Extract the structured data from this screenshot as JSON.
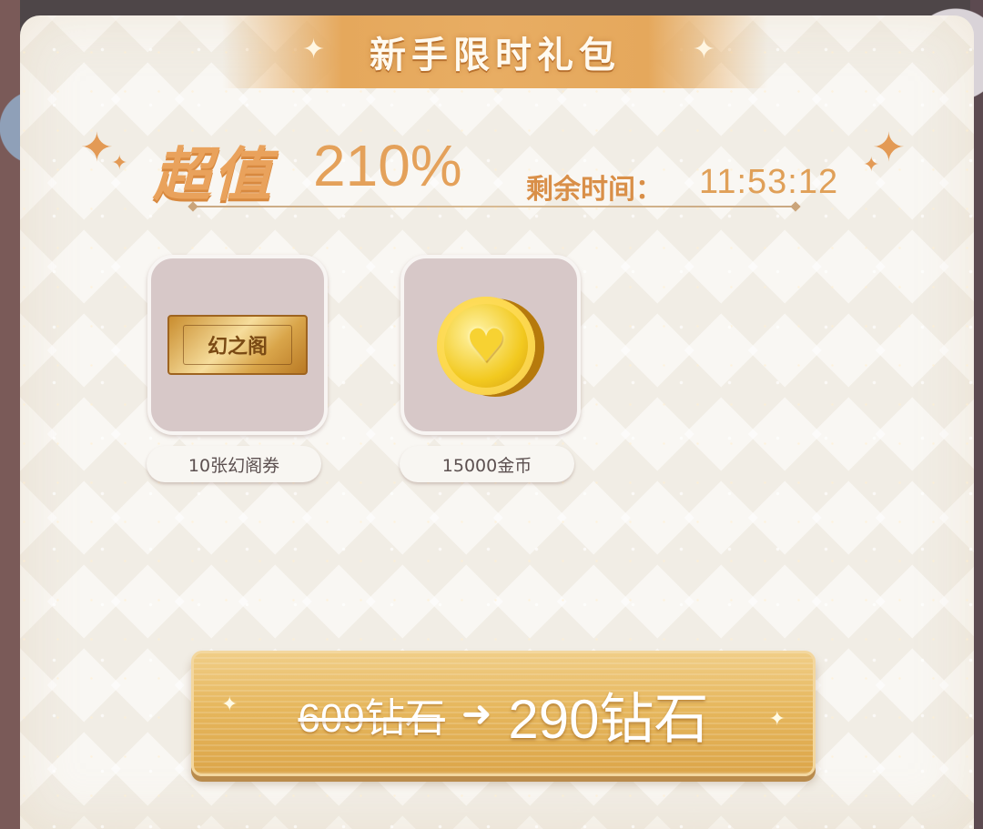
{
  "title": "新手限时礼包",
  "offer": {
    "value_label": "超值",
    "value_percent": "210%",
    "remain_label": "剩余时间：",
    "remain_time": "11:53:12"
  },
  "rewards": [
    {
      "name": "10张幻阁券",
      "icon": "ticket-icon",
      "icon_text": "幻之阁"
    },
    {
      "name": "15000金币",
      "icon": "gold-coin-icon"
    }
  ],
  "purchase": {
    "old_price": "609钻石",
    "arrow": "➜",
    "new_price": "290钻石"
  },
  "colors": {
    "accent": "#e5a85c",
    "button": "#e6b75d",
    "panel": "#f1ede5"
  }
}
